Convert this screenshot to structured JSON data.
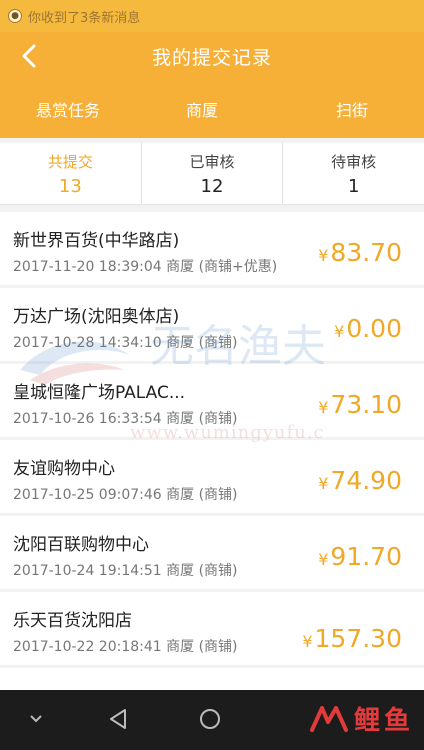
{
  "notification": {
    "text": "你收到了3条新消息"
  },
  "header": {
    "title": "我的提交记录"
  },
  "tabs": [
    {
      "label": "悬赏任务"
    },
    {
      "label": "商厦"
    },
    {
      "label": "扫街"
    }
  ],
  "stats": [
    {
      "label": "共提交",
      "value": "13",
      "active": true
    },
    {
      "label": "已审核",
      "value": "12",
      "active": false
    },
    {
      "label": "待审核",
      "value": "1",
      "active": false
    }
  ],
  "currency": "¥",
  "records": [
    {
      "name": "新世界百货(中华路店)",
      "meta": "2017-11-20 18:39:04 商厦 (商铺+优惠)",
      "amount": "83.70"
    },
    {
      "name": "万达广场(沈阳奥体店)",
      "meta": "2017-10-28 14:34:10 商厦 (商铺)",
      "amount": "0.00"
    },
    {
      "name": "皇城恒隆广场PALAC...",
      "meta": "2017-10-26 16:33:54 商厦 (商铺)",
      "amount": "73.10"
    },
    {
      "name": "友谊购物中心",
      "meta": "2017-10-25 09:07:46 商厦 (商铺)",
      "amount": "74.90"
    },
    {
      "name": "沈阳百联购物中心",
      "meta": "2017-10-24 19:14:51 商厦 (商铺)",
      "amount": "91.70"
    },
    {
      "name": "乐天百货沈阳店",
      "meta": "2017-10-22 20:18:41 商厦 (商铺)",
      "amount": "157.30"
    }
  ],
  "watermark": {
    "text": "无名渔夫",
    "url": "www.wumingyufu.c"
  },
  "brand": {
    "chars": [
      "鲤",
      "鱼"
    ]
  },
  "colors": {
    "accent": "#f7b037",
    "amount": "#f0a826",
    "navbar": "#1c1c1c"
  }
}
